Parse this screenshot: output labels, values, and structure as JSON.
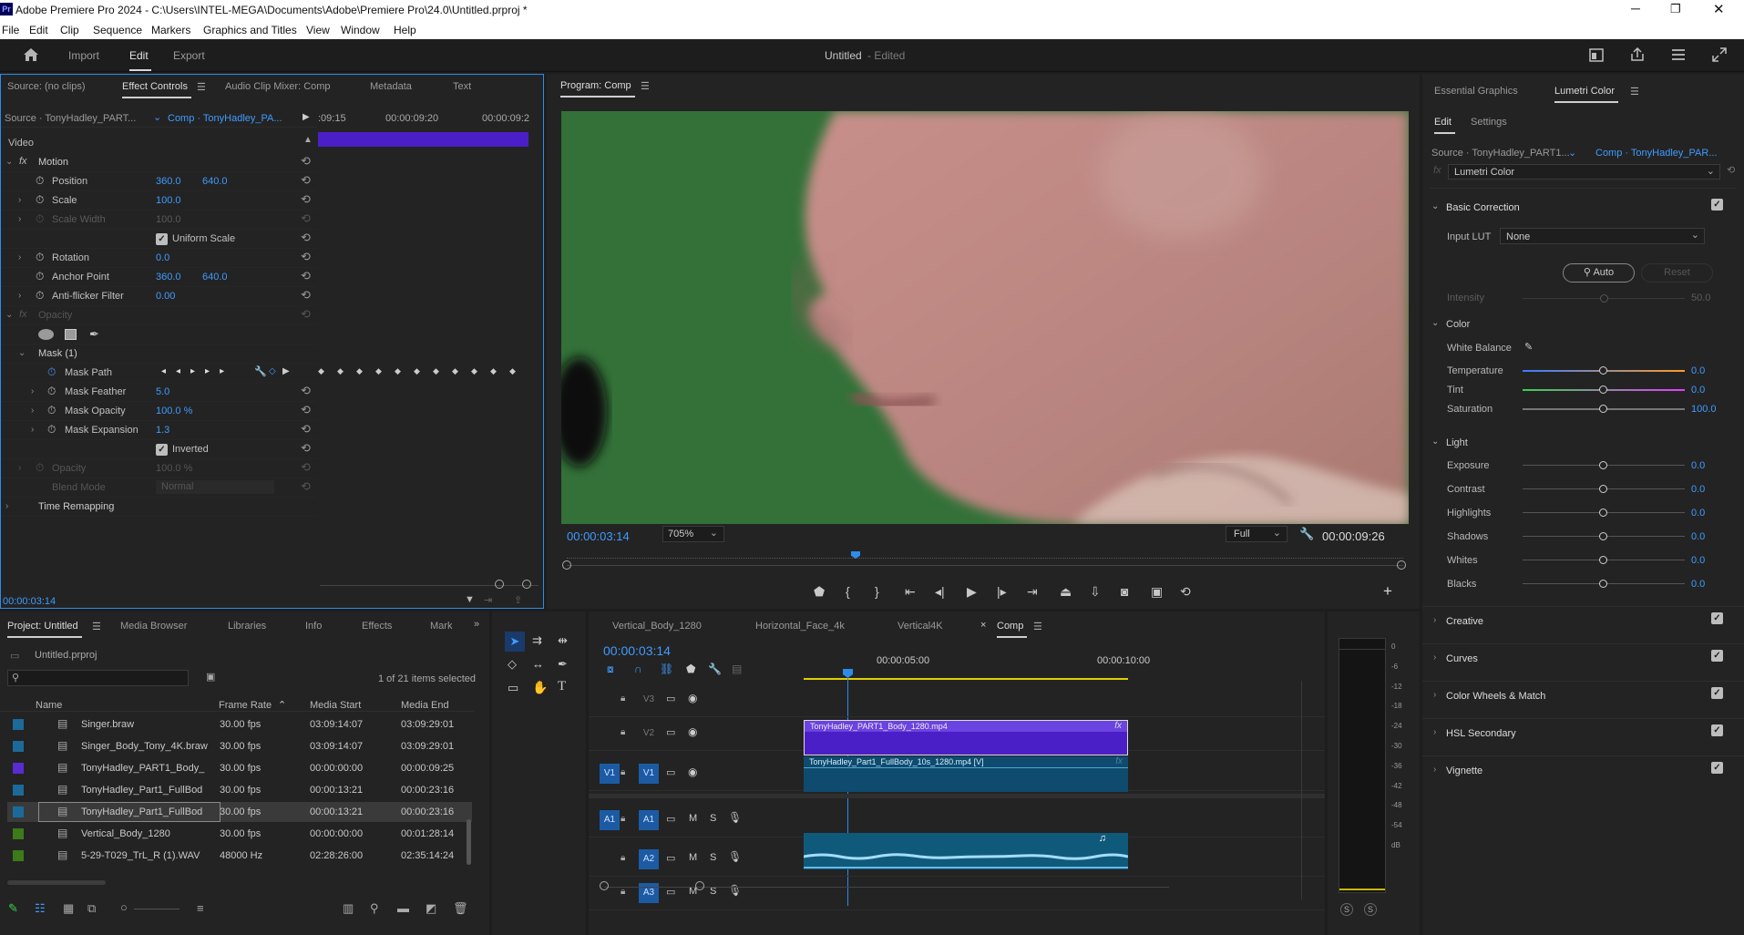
{
  "app": {
    "title": "Adobe Premiere Pro 2024 - C:\\Users\\INTEL-MEGA\\Documents\\Adobe\\Premiere Pro\\24.0\\Untitled.prproj *",
    "logo": "Pr"
  },
  "menu": [
    "File",
    "Edit",
    "Clip",
    "Sequence",
    "Markers",
    "Graphics and Titles",
    "View",
    "Window",
    "Help"
  ],
  "workspace": {
    "tabs": [
      "Import",
      "Edit",
      "Export"
    ],
    "project_title": "Untitled",
    "edited": "- Edited"
  },
  "effect_controls": {
    "tabs": [
      "Source: (no clips)",
      "Effect Controls",
      "Audio Clip Mixer: Comp",
      "Metadata",
      "Text"
    ],
    "source_label": "Source · TonyHadley_PART...",
    "comp_label": "Comp · TonyHadley_PA...",
    "ruler": [
      ":09:15",
      "00:00:09:20",
      "00:00:09:2"
    ],
    "video_label": "Video",
    "motion": "Motion",
    "rows": [
      {
        "name": "Position",
        "v1": "360.0",
        "v2": "640.0"
      },
      {
        "name": "Scale",
        "v1": "100.0",
        "v2": ""
      },
      {
        "name": "Scale Width",
        "v1": "100.0",
        "v2": ""
      },
      {
        "name": "Uniform Scale",
        "v1": "",
        "v2": ""
      },
      {
        "name": "Rotation",
        "v1": "0.0",
        "v2": ""
      },
      {
        "name": "Anchor Point",
        "v1": "360.0",
        "v2": "640.0"
      },
      {
        "name": "Anti-flicker Filter",
        "v1": "0.00",
        "v2": ""
      }
    ],
    "opacity": "Opacity",
    "mask": "Mask (1)",
    "mask_rows": [
      {
        "name": "Mask Path",
        "v": ""
      },
      {
        "name": "Mask Feather",
        "v": "5.0"
      },
      {
        "name": "Mask Opacity",
        "v": "100.0 %"
      },
      {
        "name": "Mask Expansion",
        "v": "1.3"
      },
      {
        "name": "Inverted",
        "v": ""
      }
    ],
    "opacity2": "Opacity",
    "opacity2_val": "100.0 %",
    "blend": "Blend Mode",
    "blend_val": "Normal",
    "time_remap": "Time Remapping",
    "timecode": "00:00:03:14"
  },
  "program": {
    "title": "Program: Comp",
    "timecode": "00:00:03:14",
    "zoom": "705%",
    "quality": "Full",
    "duration": "00:00:09:26"
  },
  "lumetri": {
    "tabs": [
      "Essential Graphics",
      "Lumetri Color"
    ],
    "subtabs": [
      "Edit",
      "Settings"
    ],
    "source": "Source · TonyHadley_PART1...",
    "comp": "Comp · TonyHadley_PAR...",
    "effect": "Lumetri Color",
    "basic": "Basic Correction",
    "input_lut": "Input LUT",
    "lut_val": "None",
    "auto": "Auto",
    "reset": "Reset",
    "intensity": "Intensity",
    "intensity_val": "50.0",
    "color": "Color",
    "white_balance": "White Balance",
    "color_rows": [
      {
        "name": "Temperature",
        "v": "0.0",
        "grad": "linear-gradient(90deg,#3a7bff,#ff9a2a)"
      },
      {
        "name": "Tint",
        "v": "0.0",
        "grad": "linear-gradient(90deg,#3bd14a,#e63cff)"
      },
      {
        "name": "Saturation",
        "v": "100.0",
        "grad": "#777"
      }
    ],
    "light": "Light",
    "light_rows": [
      {
        "name": "Exposure",
        "v": "0.0"
      },
      {
        "name": "Contrast",
        "v": "0.0"
      },
      {
        "name": "Highlights",
        "v": "0.0"
      },
      {
        "name": "Shadows",
        "v": "0.0"
      },
      {
        "name": "Whites",
        "v": "0.0"
      },
      {
        "name": "Blacks",
        "v": "0.0"
      }
    ],
    "sections": [
      "Creative",
      "Curves",
      "Color Wheels & Match",
      "HSL Secondary",
      "Vignette"
    ]
  },
  "project": {
    "tabs": [
      "Project: Untitled",
      "Media Browser",
      "Libraries",
      "Info",
      "Effects",
      "Mark"
    ],
    "file": "Untitled.prproj",
    "selected": "1 of 21 items selected",
    "columns": [
      "Name",
      "Frame Rate",
      "Media Start",
      "Media End"
    ],
    "rows": [
      {
        "name": "Singer.braw",
        "rate": "30.00 fps",
        "start": "03:09:14:07",
        "end": "03:09:29:01",
        "color": "#1b6a9a"
      },
      {
        "name": "Singer_Body_Tony_4K.braw",
        "rate": "30.00 fps",
        "start": "03:09:14:07",
        "end": "03:09:29:01",
        "color": "#1b6a9a"
      },
      {
        "name": "TonyHadley_PART1_Body_",
        "rate": "30.00 fps",
        "start": "00:00:00:00",
        "end": "00:00:09:25",
        "color": "#5a2bd0"
      },
      {
        "name": "TonyHadley_Part1_FullBod",
        "rate": "30.00 fps",
        "start": "00:00:13:21",
        "end": "00:00:23:16",
        "color": "#1b6a9a"
      },
      {
        "name": "TonyHadley_Part1_FullBod",
        "rate": "30.00 fps",
        "start": "00:00:13:21",
        "end": "00:00:23:16",
        "color": "#1b6a9a"
      },
      {
        "name": "Vertical_Body_1280",
        "rate": "30.00 fps",
        "start": "00:00:00:00",
        "end": "00:01:28:14",
        "color": "#3d7a1a"
      },
      {
        "name": "5-29-T029_TrL_R (1).WAV",
        "rate": "48000 Hz",
        "start": "02:28:26:00",
        "end": "02:35:14:24",
        "color": "#3d7a1a"
      }
    ]
  },
  "timeline": {
    "tabs": [
      "Vertical_Body_1280",
      "Horizontal_Face_4k",
      "Vertical4K",
      "Comp"
    ],
    "timecode": "00:00:03:14",
    "ruler": [
      "00:00:05:00",
      "00:00:10:00"
    ],
    "tracks": [
      "V3",
      "V2",
      "V1",
      "A1",
      "A2",
      "A3"
    ],
    "clip_v2": "TonyHadley_PART1_Body_1280.mp4",
    "clip_v1": "TonyHadley_Part1_FullBody_10s_1280.mp4 [V]",
    "fx": "fx"
  },
  "meter": {
    "scale": [
      "0",
      "-6",
      "-12",
      "-18",
      "-24",
      "-30",
      "-36",
      "-42",
      "-48",
      "-54",
      "dB"
    ],
    "solo": [
      "S",
      "S"
    ]
  }
}
